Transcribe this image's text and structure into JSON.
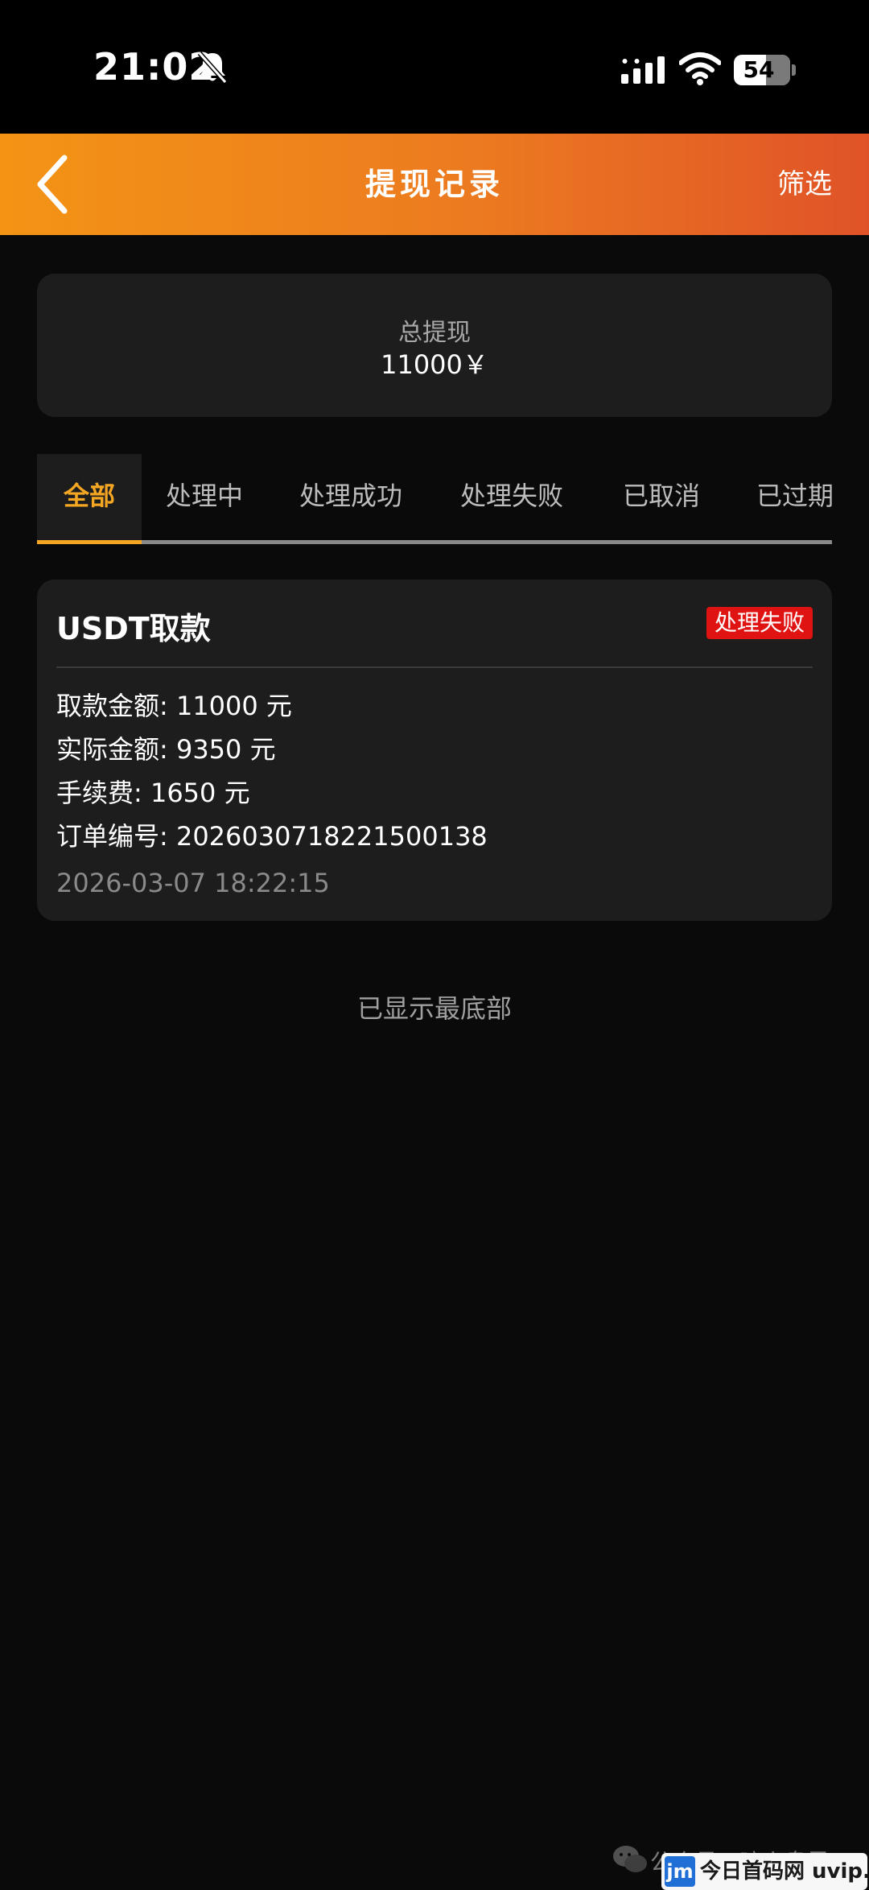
{
  "status_bar": {
    "time": "21:02",
    "battery": "54",
    "icons": [
      "bell-slash-icon",
      "signal-icon",
      "wifi-icon",
      "battery-icon"
    ]
  },
  "header": {
    "title": "提现记录",
    "filter_label": "筛选",
    "back_icon": "chevron-left-icon",
    "gradient_colors": [
      "#f39415",
      "#e05328"
    ]
  },
  "summary": {
    "label": "总提现",
    "value": "11000￥"
  },
  "tabs": [
    {
      "label": "全部",
      "active": true
    },
    {
      "label": "处理中",
      "active": false
    },
    {
      "label": "处理成功",
      "active": false
    },
    {
      "label": "处理失败",
      "active": false
    },
    {
      "label": "已取消",
      "active": false
    },
    {
      "label": "已过期",
      "active": false
    }
  ],
  "records": [
    {
      "title": "USDT取款",
      "status": "处理失败",
      "status_color": "#e01313",
      "amount": "取款金额: 11000 元",
      "actual_amount": "实际金额: 9350 元",
      "fee": "手续费: 1650 元",
      "order_no": "订单编号: 2026030718221500138",
      "time": "2026-03-07 18:22:15"
    }
  ],
  "end_text": "已显示最底部",
  "watermark": {
    "text": "公众号 · 暗火盘界",
    "logo_mark": "jm",
    "logo_text": "今日首码网 uvip.cc"
  },
  "accent_color": "#f5a623"
}
